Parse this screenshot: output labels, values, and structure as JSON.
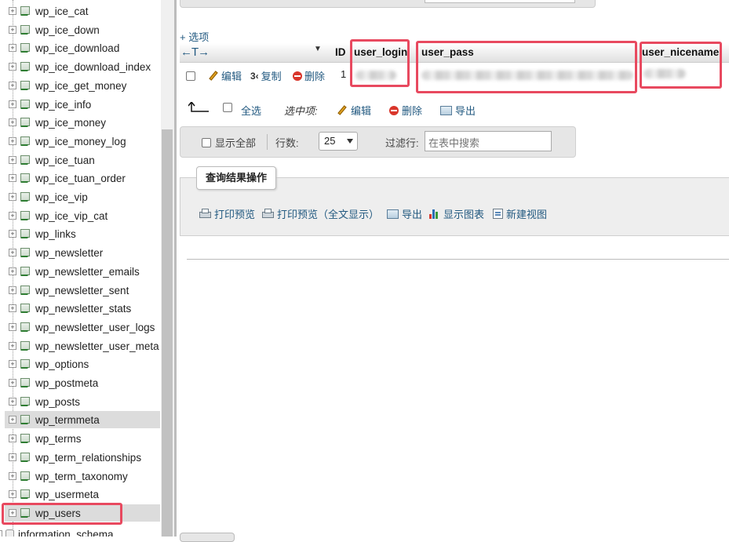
{
  "sidebar": {
    "tables": [
      "wp_ice_cat",
      "wp_ice_down",
      "wp_ice_download",
      "wp_ice_download_index",
      "wp_ice_get_money",
      "wp_ice_info",
      "wp_ice_money",
      "wp_ice_money_log",
      "wp_ice_tuan",
      "wp_ice_tuan_order",
      "wp_ice_vip",
      "wp_ice_vip_cat",
      "wp_links",
      "wp_newsletter",
      "wp_newsletter_emails",
      "wp_newsletter_sent",
      "wp_newsletter_stats",
      "wp_newsletter_user_logs",
      "wp_newsletter_user_meta",
      "wp_options",
      "wp_postmeta",
      "wp_posts",
      "wp_termmeta",
      "wp_terms",
      "wp_term_relationships",
      "wp_term_taxonomy",
      "wp_usermeta",
      "wp_users"
    ],
    "database": "information_schema",
    "highlighted": [
      "wp_termmeta",
      "wp_users"
    ]
  },
  "results": {
    "options_link": "+ 选项",
    "columns": {
      "id": "ID",
      "user_login": "user_login",
      "user_pass": "user_pass",
      "user_nicename": "user_nicename"
    },
    "row": {
      "id": "1",
      "edit": "编辑",
      "copy": "复制",
      "delete": "删除"
    },
    "with_selected": {
      "check_all": "全选",
      "label": "选中项:",
      "edit": "编辑",
      "delete": "删除",
      "export": "导出"
    }
  },
  "navbar": {
    "show_all": "显示全部",
    "rows_label": "行数:",
    "rows_value": "25",
    "filter_label": "过滤行:",
    "filter_placeholder": "在表中搜索"
  },
  "query_ops": {
    "title": "查询结果操作",
    "print_view": "打印预览",
    "print_view_full": "打印预览（全文显示）",
    "export": "导出",
    "display_chart": "显示图表",
    "create_view": "新建视图"
  },
  "colors": {
    "link": "#235a81",
    "highlight_box": "#e8495f",
    "delete_icon": "#d9362b"
  }
}
